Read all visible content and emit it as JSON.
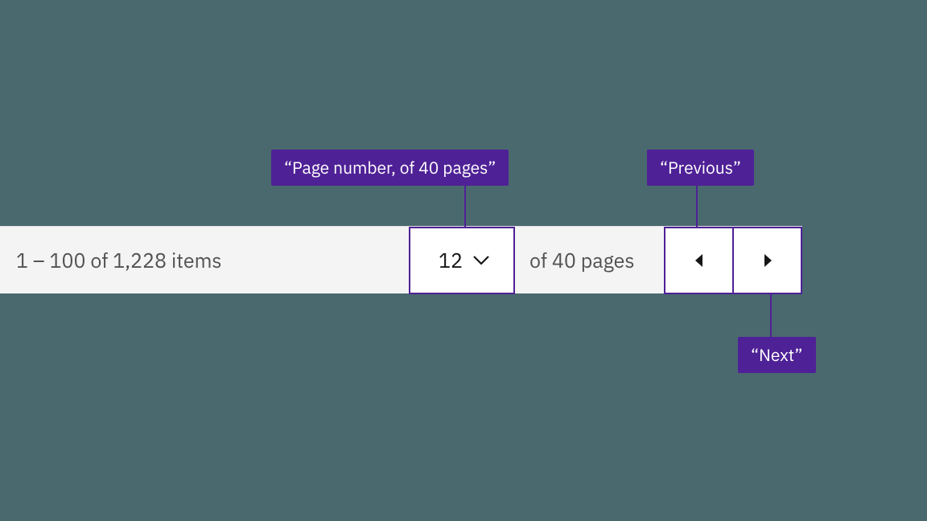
{
  "pagination": {
    "items_summary": "1 – 100 of 1,228 items",
    "current_page": "12",
    "of_pages": "of 40 pages"
  },
  "annotations": {
    "page_number": "“Page number, of 40 pages”",
    "previous": "“Previous”",
    "next": "“Next”"
  },
  "colors": {
    "accent": "#4f2196",
    "app_bg": "#4a696f",
    "bar_bg": "#f4f4f4"
  }
}
